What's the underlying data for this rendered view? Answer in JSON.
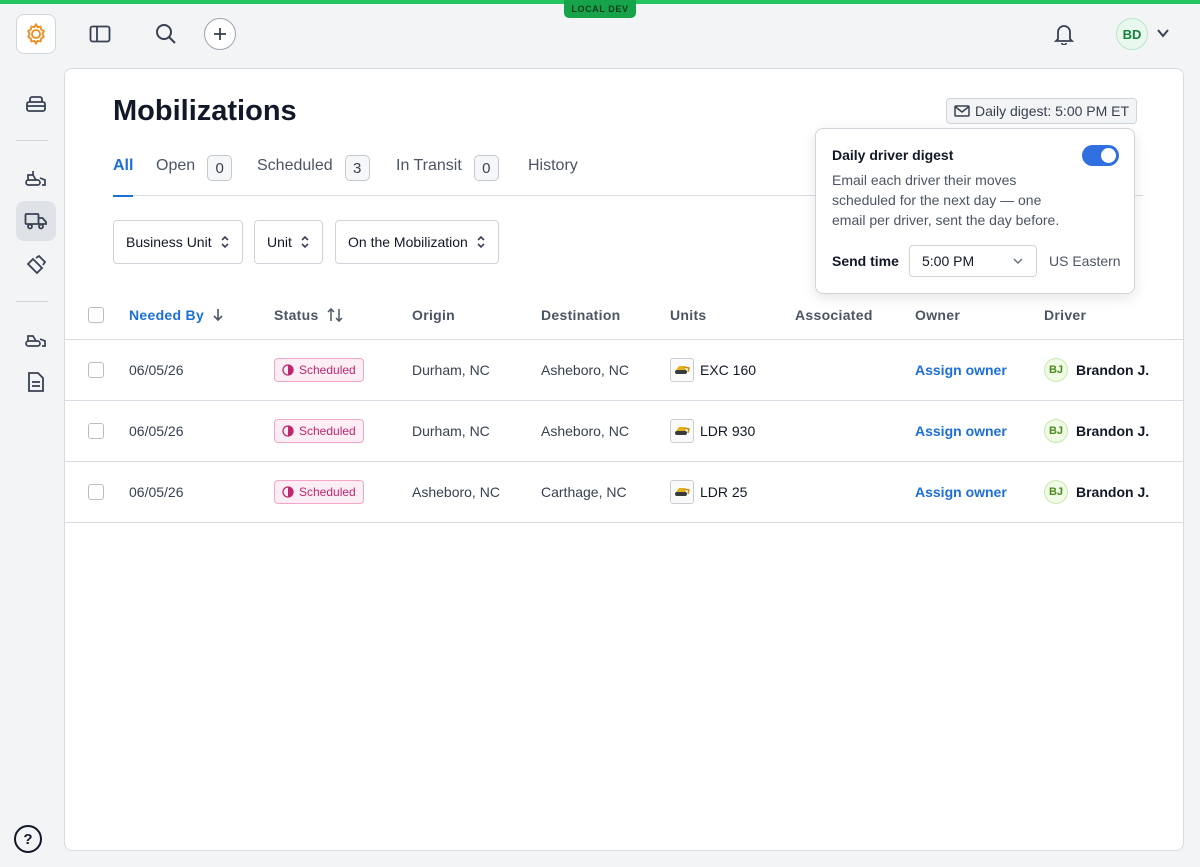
{
  "env_badge": "LOCAL DEV",
  "user": {
    "initials": "BD"
  },
  "page": {
    "title": "Mobilizations",
    "digest_button": "Daily digest: 5:00 PM ET"
  },
  "tabs": [
    {
      "label": "All",
      "count": null
    },
    {
      "label": "Open",
      "count": "0"
    },
    {
      "label": "Scheduled",
      "count": "3"
    },
    {
      "label": "In Transit",
      "count": "0"
    },
    {
      "label": "History",
      "count": null
    }
  ],
  "filters": [
    "Business Unit",
    "Unit",
    "On the Mobilization"
  ],
  "columns": {
    "needed_by": "Needed By",
    "status": "Status",
    "origin": "Origin",
    "destination": "Destination",
    "units": "Units",
    "associated": "Associated",
    "owner": "Owner",
    "driver": "Driver"
  },
  "rows": [
    {
      "needed_by": "06/05/26",
      "status": "Scheduled",
      "origin": "Durham, NC",
      "destination": "Asheboro, NC",
      "unit": "EXC 160",
      "owner": "Assign owner",
      "driver_initials": "BJ",
      "driver": "Brandon J."
    },
    {
      "needed_by": "06/05/26",
      "status": "Scheduled",
      "origin": "Durham, NC",
      "destination": "Asheboro, NC",
      "unit": "LDR 930",
      "owner": "Assign owner",
      "driver_initials": "BJ",
      "driver": "Brandon J."
    },
    {
      "needed_by": "06/05/26",
      "status": "Scheduled",
      "origin": "Asheboro, NC",
      "destination": "Carthage, NC",
      "unit": "LDR 25",
      "owner": "Assign owner",
      "driver_initials": "BJ",
      "driver": "Brandon J."
    }
  ],
  "popover": {
    "title": "Daily driver digest",
    "description": "Email each driver their moves scheduled for the next day — one email per driver, sent the day before.",
    "enabled": true,
    "send_time_label": "Send time",
    "send_time": "5:00 PM",
    "timezone": "US Eastern"
  },
  "colors": {
    "accent": "#1d6fd8",
    "env_green": "#22c55e",
    "status_scheduled": "#c0266d",
    "toggle_on": "#2f6fe0"
  },
  "icons": {
    "logo": "gear-logo-icon",
    "sidebar_toggle": "sidebar-panel-icon",
    "search": "search-icon",
    "add": "plus-icon",
    "notifications": "bell-icon",
    "help": "help-icon"
  }
}
